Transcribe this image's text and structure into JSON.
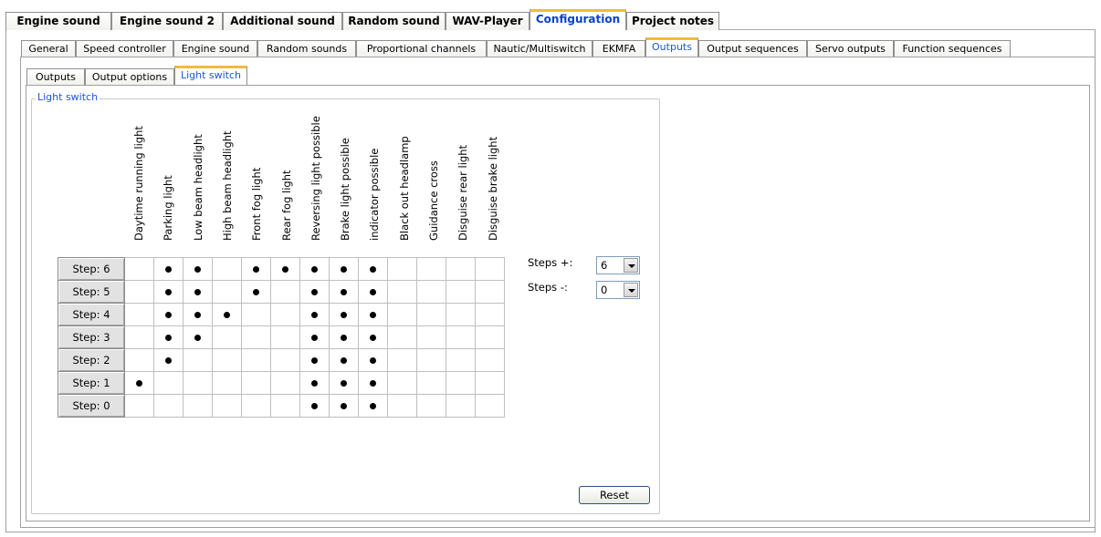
{
  "top_tabs": [
    {
      "label": "Engine sound"
    },
    {
      "label": "Engine sound 2"
    },
    {
      "label": "Additional sound"
    },
    {
      "label": "Random sound"
    },
    {
      "label": "WAV-Player"
    },
    {
      "label": "Configuration",
      "active": true
    },
    {
      "label": "Project notes"
    }
  ],
  "config_tabs": [
    {
      "label": "General"
    },
    {
      "label": "Speed controller"
    },
    {
      "label": "Engine sound"
    },
    {
      "label": "Random sounds"
    },
    {
      "label": "Proportional channels"
    },
    {
      "label": "Nautic/Multiswitch"
    },
    {
      "label": "EKMFA"
    },
    {
      "label": "Outputs",
      "active": true
    },
    {
      "label": "Output sequences"
    },
    {
      "label": "Servo outputs"
    },
    {
      "label": "Function sequences"
    }
  ],
  "output_tabs": [
    {
      "label": "Outputs"
    },
    {
      "label": "Output options"
    },
    {
      "label": "Light switch",
      "active": true
    }
  ],
  "light_switch": {
    "group_title": "Light switch",
    "columns": [
      "Daytime running light",
      "Parking light",
      "Low beam headlight",
      "High beam headlight",
      "Front fog light",
      "Rear fog light",
      "Reversing light possible",
      "Brake light possible",
      "indicator possible",
      "Black out headlamp",
      "Guidance cross",
      "Disguise rear light",
      "Disguise brake light"
    ],
    "rows": [
      {
        "label": "Step: 6",
        "values": [
          0,
          1,
          1,
          0,
          1,
          1,
          1,
          1,
          1,
          0,
          0,
          0,
          0
        ]
      },
      {
        "label": "Step: 5",
        "values": [
          0,
          1,
          1,
          0,
          1,
          0,
          1,
          1,
          1,
          0,
          0,
          0,
          0
        ]
      },
      {
        "label": "Step: 4",
        "values": [
          0,
          1,
          1,
          1,
          0,
          0,
          1,
          1,
          1,
          0,
          0,
          0,
          0
        ]
      },
      {
        "label": "Step: 3",
        "values": [
          0,
          1,
          1,
          0,
          0,
          0,
          1,
          1,
          1,
          0,
          0,
          0,
          0
        ]
      },
      {
        "label": "Step: 2",
        "values": [
          0,
          1,
          0,
          0,
          0,
          0,
          1,
          1,
          1,
          0,
          0,
          0,
          0
        ]
      },
      {
        "label": "Step: 1",
        "values": [
          1,
          0,
          0,
          0,
          0,
          0,
          1,
          1,
          1,
          0,
          0,
          0,
          0
        ]
      },
      {
        "label": "Step: 0",
        "values": [
          0,
          0,
          0,
          0,
          0,
          0,
          1,
          1,
          1,
          0,
          0,
          0,
          0
        ]
      }
    ],
    "steps_plus": {
      "label": "Steps +:",
      "value": "6"
    },
    "steps_minus": {
      "label": "Steps -:",
      "value": "0"
    },
    "reset_label": "Reset"
  }
}
